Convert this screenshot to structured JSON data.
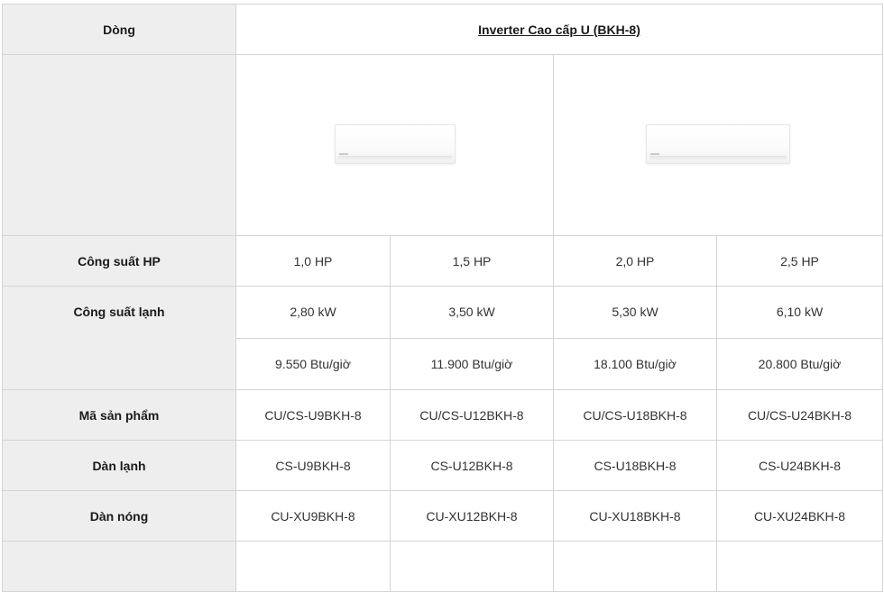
{
  "header": {
    "label": "Dòng",
    "model_line": "Inverter Cao cấp U (BKH-8)"
  },
  "images": [
    {
      "icon": "air-conditioner-indoor-unit"
    },
    {
      "icon": "air-conditioner-indoor-unit"
    }
  ],
  "rows": {
    "hp": {
      "label": "Công suất HP",
      "values": [
        "1,0 HP",
        "1,5 HP",
        "2,0 HP",
        "2,5 HP"
      ]
    },
    "cooling": {
      "label": "Công suất lạnh",
      "kw": [
        "2,80 kW",
        "3,50 kW",
        "5,30 kW",
        "6,10 kW"
      ],
      "btu": [
        "9.550 Btu/giờ",
        "11.900 Btu/giờ",
        "18.100 Btu/giờ",
        "20.800 Btu/giờ"
      ]
    },
    "product_code": {
      "label": "Mã sản phẩm",
      "values": [
        "CU/CS-U9BKH-8",
        "CU/CS-U12BKH-8",
        "CU/CS-U18BKH-8",
        "CU/CS-U24BKH-8"
      ]
    },
    "indoor": {
      "label": "Dàn lạnh",
      "values": [
        "CS-U9BKH-8",
        "CS-U12BKH-8",
        "CS-U18BKH-8",
        "CS-U24BKH-8"
      ]
    },
    "outdoor": {
      "label": "Dàn nóng",
      "values": [
        "CU-XU9BKH-8",
        "CU-XU12BKH-8",
        "CU-XU18BKH-8",
        "CU-XU24BKH-8"
      ]
    }
  }
}
